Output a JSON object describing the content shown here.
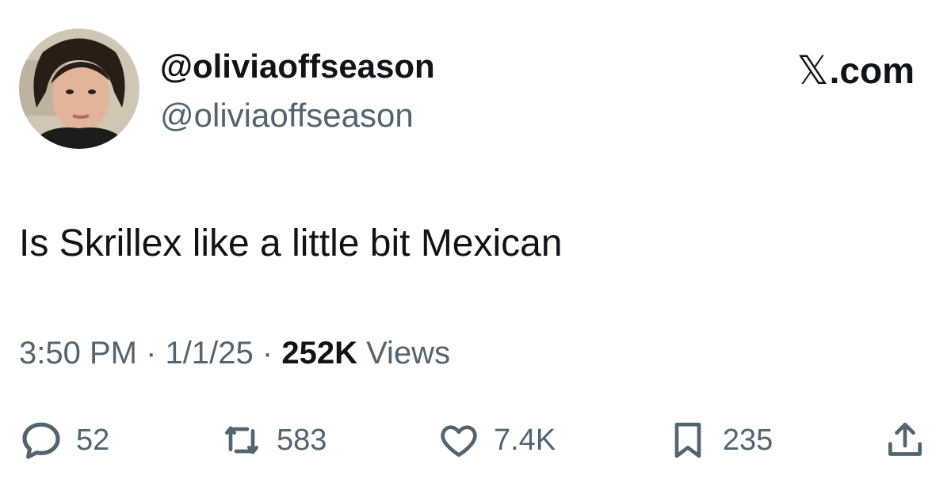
{
  "author": {
    "display_name": "@oliviaoffseason",
    "handle": "@oliviaoffseason",
    "avatar": "profile-photo"
  },
  "brand": {
    "glyph": "𝕏",
    "suffix": ".com"
  },
  "tweet": {
    "text": "Is Skrillex like a little bit Mexican"
  },
  "meta": {
    "time": "3:50 PM",
    "separator": "·",
    "date": "1/1/25",
    "views_count": "252K",
    "views_label": "Views"
  },
  "actions": {
    "replies": {
      "icon": "reply-icon",
      "count": "52"
    },
    "reposts": {
      "icon": "repost-icon",
      "count": "583"
    },
    "likes": {
      "icon": "heart-icon",
      "count": "7.4K"
    },
    "bookmarks": {
      "icon": "bookmark-icon",
      "count": "235"
    },
    "share": {
      "icon": "share-icon"
    }
  },
  "colors": {
    "text_primary": "#0f1419",
    "text_secondary": "#536471",
    "background": "#ffffff"
  }
}
